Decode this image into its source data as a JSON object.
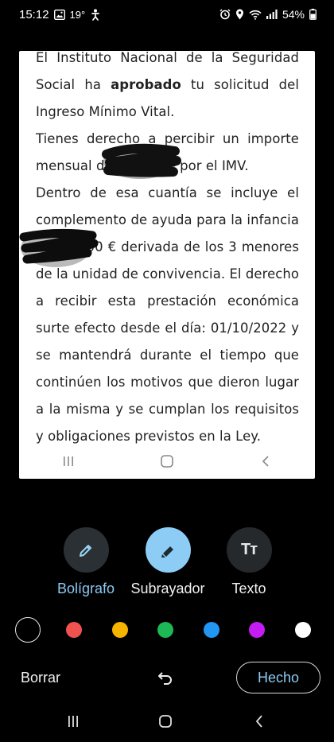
{
  "status_bar": {
    "time": "15:12",
    "temperature": "19°",
    "battery": "54%",
    "icons": [
      "gallery-icon",
      "weather-icon",
      "accessibility-icon",
      "alarm-icon",
      "location-icon",
      "wifi-icon",
      "signal-icon",
      "battery-icon"
    ]
  },
  "document": {
    "paragraph_1_pre": "El Instituto Nacional de la Seguridad Social ha ",
    "paragraph_1_bold": "aprobado",
    "paragraph_1_post": " tu solicitud del Ingreso Mínimo Vital.",
    "paragraph_2": "Tienes derecho a percibir un importe mensual de 685,77 € por el IMV.",
    "paragraph_3": "Dentro de esa cuantía se incluye el complemento de ayuda para la infancia de 100,00 € derivada de los 3 menores de la unidad de convivencia. El derecho a recibir esta prestación económica surte efecto desde el día: 01/10/2022 y se mantendrá durante el tiempo que continúen los motivos que dieron lugar a la misma y se cumplan los requisitos y obligaciones previstos en la Ley."
  },
  "tools": {
    "pen_label": "Bolígrafo",
    "highlighter_label": "Subrayador",
    "text_label": "Texto",
    "text_icon_glyph": "Tт",
    "selected": "highlighter"
  },
  "palette": {
    "colors": [
      "#000000",
      "#ef5350",
      "#f4b400",
      "#1db954",
      "#2196f3",
      "#c41cf2",
      "#ffffff"
    ],
    "selected": "#000000"
  },
  "actions": {
    "clear_label": "Borrar",
    "done_label": "Hecho"
  }
}
